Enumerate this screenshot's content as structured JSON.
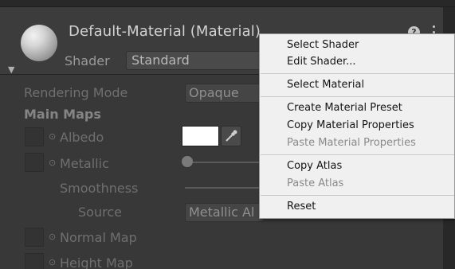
{
  "material": {
    "title": "Default-Material (Material)",
    "shader_label": "Shader",
    "shader_value": "Standard",
    "help_glyph": "?"
  },
  "properties": {
    "rendering_mode_label": "Rendering Mode",
    "rendering_mode_value": "Opaque",
    "main_maps_label": "Main Maps",
    "albedo_label": "Albedo",
    "albedo_color": "#ffffff",
    "metallic_label": "Metallic",
    "smoothness_label": "Smoothness",
    "source_label": "Source",
    "source_value": "Metallic Al",
    "normal_map_label": "Normal Map",
    "height_map_label": "Height Map",
    "circle_mark": "⊙"
  },
  "context_menu": {
    "items": [
      {
        "label": "Select Shader",
        "enabled": true
      },
      {
        "label": "Edit Shader...",
        "enabled": true
      },
      {
        "label": "Select Material",
        "enabled": true
      },
      {
        "label": "Create Material Preset",
        "enabled": true
      },
      {
        "label": "Copy Material Properties",
        "enabled": true
      },
      {
        "label": "Paste Material Properties",
        "enabled": false
      },
      {
        "label": "Copy Atlas",
        "enabled": true
      },
      {
        "label": "Paste Atlas",
        "enabled": false
      },
      {
        "label": "Reset",
        "enabled": true
      }
    ]
  },
  "icons": {
    "help": "help-icon",
    "menu": "kebab-menu-icon",
    "eyedropper": "eyedropper-icon",
    "foldout": "foldout-arrow-icon"
  },
  "colors": {
    "panel_bg": "#383838",
    "menu_bg": "#f0f0f0",
    "disabled_text": "#8a8a8a"
  }
}
